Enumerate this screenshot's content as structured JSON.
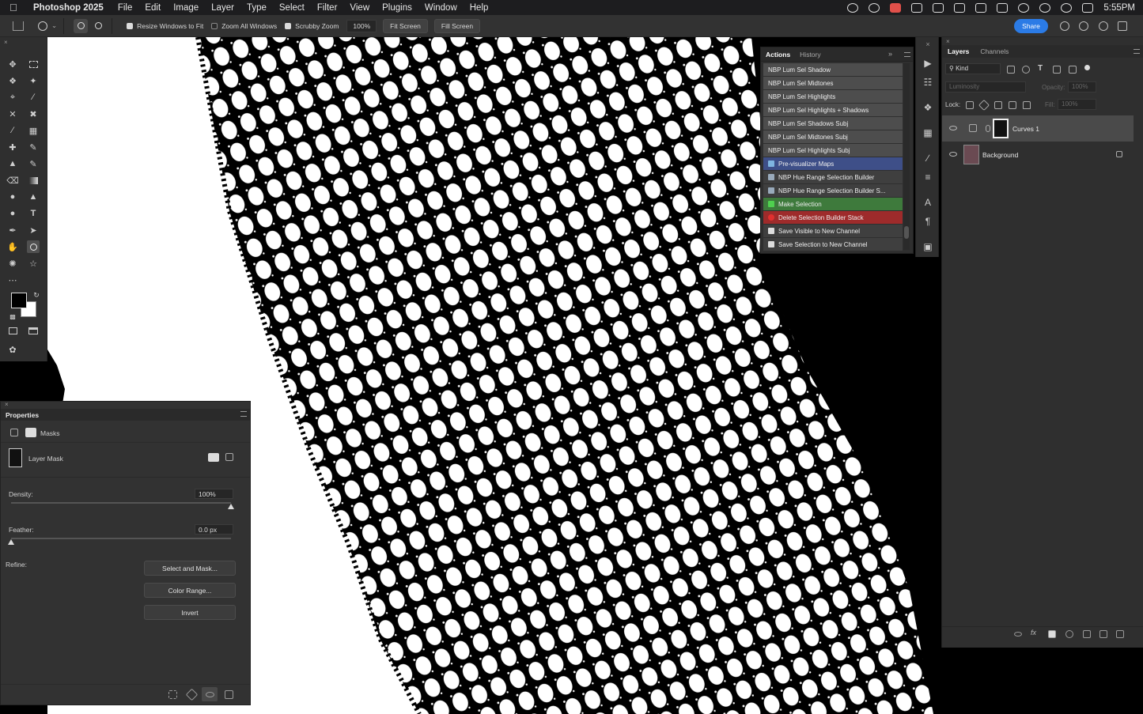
{
  "menubar": {
    "app_name": "Photoshop 2025",
    "items": [
      "File",
      "Edit",
      "Image",
      "Layer",
      "Type",
      "Select",
      "Filter",
      "View",
      "Plugins",
      "Window",
      "Help"
    ],
    "clock": "5:55PM"
  },
  "options_bar": {
    "resize_windows_label": "Resize Windows to Fit",
    "resize_windows_checked": true,
    "zoom_all_windows_label": "Zoom All Windows",
    "zoom_all_windows_checked": false,
    "scrubby_zoom_label": "Scrubby Zoom",
    "scrubby_zoom_checked": true,
    "zoom_value": "100%",
    "fit_screen_label": "Fit Screen",
    "fill_screen_label": "Fill Screen",
    "share_label": "Share",
    "share_color": "#2b7be6"
  },
  "properties": {
    "title": "Properties",
    "section_label": "Masks",
    "mask_type": "Layer Mask",
    "density_label": "Density:",
    "density_value": "100%",
    "feather_label": "Feather:",
    "feather_value": "0.0 px",
    "refine_label": "Refine:",
    "select_mask_label": "Select and Mask...",
    "color_range_label": "Color Range...",
    "invert_label": "Invert"
  },
  "actions_panel": {
    "tabs": [
      "Actions",
      "History"
    ],
    "items": [
      {
        "label": "NBP Lum Sel Shadow",
        "style": "gray",
        "icon": ""
      },
      {
        "label": "NBP Lum Sel Midtones",
        "style": "gray",
        "icon": ""
      },
      {
        "label": "NBP Lum Sel Highlights",
        "style": "gray",
        "icon": ""
      },
      {
        "label": "NBP Lum Sel Highlights + Shadows",
        "style": "gray",
        "icon": ""
      },
      {
        "label": "NBP Lum Sel Shadows Subj",
        "style": "gray",
        "icon": ""
      },
      {
        "label": "NBP Lum Sel Midtones Subj",
        "style": "gray",
        "icon": ""
      },
      {
        "label": "NBP Lum Sel Highlights Subj",
        "style": "gray",
        "icon": ""
      },
      {
        "label": "Pre-visualizer Maps",
        "style": "blue",
        "icon": "map-icon"
      },
      {
        "label": "NBP Hue Range Selection Builder",
        "style": "dark",
        "icon": "dropper-icon"
      },
      {
        "label": "NBP Hue Range Selection Builder S...",
        "style": "dark",
        "icon": "dropper-icon"
      },
      {
        "label": "Make Selection",
        "style": "green",
        "icon": "checkmark-icon"
      },
      {
        "label": "Delete Selection Builder Stack",
        "style": "red",
        "icon": "heart-icon"
      },
      {
        "label": "Save Visible to New Channel",
        "style": "dark",
        "icon": "document-icon"
      },
      {
        "label": "Save Selection to New Channel",
        "style": "dark",
        "icon": "document-icon"
      }
    ],
    "colors": {
      "gray": "#4d4d4d",
      "blue": "#3e4f88",
      "green": "#3e7a3c",
      "red": "#9e2b2b",
      "dark": "#3f3f3f"
    }
  },
  "layers_panel": {
    "tabs": [
      "Layers",
      "Channels"
    ],
    "filter_kind": "Kind",
    "blend_mode": "Luminosity",
    "opacity_label": "Opacity:",
    "opacity_value": "100%",
    "lock_label": "Lock:",
    "fill_label": "Fill:",
    "fill_value": "100%",
    "layers": [
      {
        "name": "Curves 1",
        "active": true,
        "locked": false
      },
      {
        "name": "Background",
        "active": false,
        "locked": true
      }
    ]
  }
}
